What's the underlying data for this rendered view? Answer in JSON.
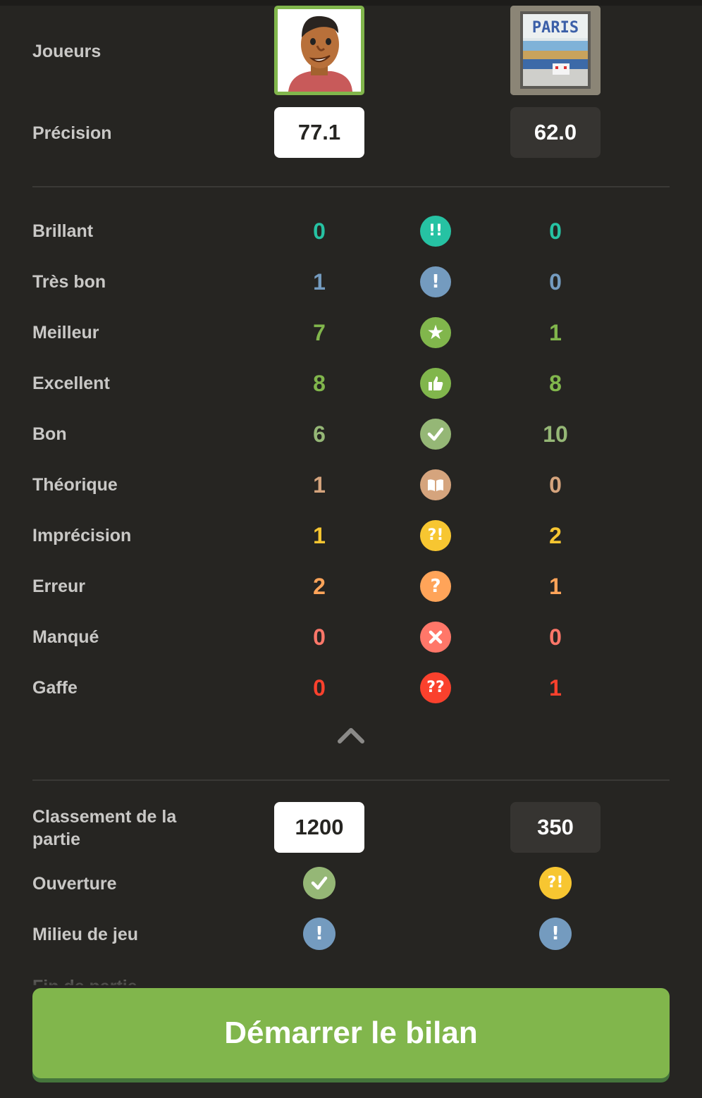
{
  "players_label": "Joueurs",
  "accuracy_label": "Précision",
  "player1": {
    "accuracy": "77.1",
    "rating": "1200"
  },
  "player2": {
    "accuracy": "62.0",
    "rating": "350"
  },
  "classifications": [
    {
      "label": "Brillant",
      "p1": "0",
      "p2": "0",
      "color": "#26c2a3",
      "icon": "brilliant-icon",
      "glyph": "!!"
    },
    {
      "label": "Très bon",
      "p1": "1",
      "p2": "0",
      "color": "#749bbf",
      "icon": "great-move-icon",
      "glyph": "!"
    },
    {
      "label": "Meilleur",
      "p1": "7",
      "p2": "1",
      "color": "#81b64c",
      "icon": "best-move-icon",
      "glyph": "★"
    },
    {
      "label": "Excellent",
      "p1": "8",
      "p2": "8",
      "color": "#81b64c",
      "icon": "excellent-icon",
      "glyph": ""
    },
    {
      "label": "Bon",
      "p1": "6",
      "p2": "10",
      "color": "#95b776",
      "icon": "good-move-icon",
      "glyph": ""
    },
    {
      "label": "Théorique",
      "p1": "1",
      "p2": "0",
      "color": "#d5a47d",
      "icon": "book-icon",
      "glyph": ""
    },
    {
      "label": "Imprécision",
      "p1": "1",
      "p2": "2",
      "color": "#f7c631",
      "icon": "inaccuracy-icon",
      "glyph": "?!"
    },
    {
      "label": "Erreur",
      "p1": "2",
      "p2": "1",
      "color": "#ffa459",
      "icon": "mistake-icon",
      "glyph": "?"
    },
    {
      "label": "Manqué",
      "p1": "0",
      "p2": "0",
      "color": "#ff7769",
      "icon": "miss-icon",
      "glyph": "✕"
    },
    {
      "label": "Gaffe",
      "p1": "0",
      "p2": "1",
      "color": "#fa412d",
      "icon": "blunder-icon",
      "glyph": "??"
    }
  ],
  "game_rating_label": "Classement de la partie",
  "phases": [
    {
      "label": "Ouverture",
      "p1_icon": "good-move-icon",
      "p1_color": "#95b776",
      "p2_icon": "inaccuracy-icon",
      "p2_color": "#f7c631",
      "p2_glyph": "?!"
    },
    {
      "label": "Milieu de jeu",
      "p1_icon": "great-move-icon",
      "p1_color": "#749bbf",
      "p1_glyph": "!",
      "p2_icon": "great-move-icon",
      "p2_color": "#749bbf",
      "p2_glyph": "!"
    }
  ],
  "cta_label": "Démarrer le bilan",
  "colors": {
    "background": "#262522",
    "accent_green": "#81b64c"
  }
}
